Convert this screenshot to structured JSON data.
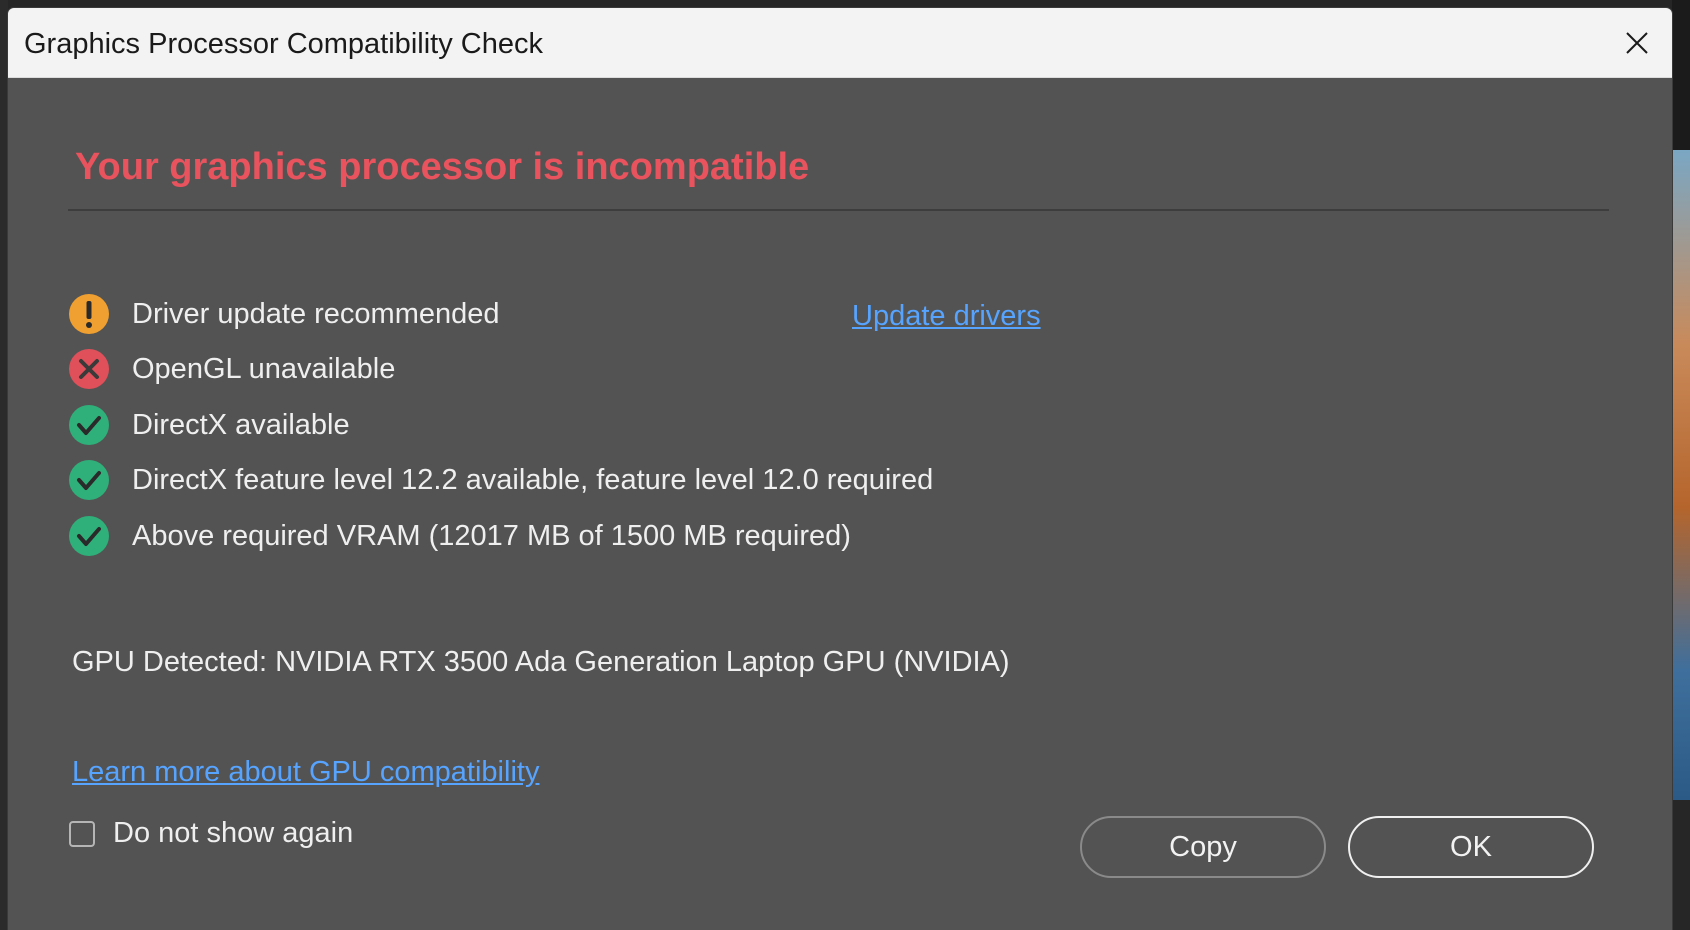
{
  "window": {
    "title": "Graphics Processor Compatibility Check"
  },
  "heading": "Your graphics processor is incompatible",
  "checks": [
    {
      "status": "warning",
      "icon": "warning-icon",
      "text": "Driver update recommended",
      "color": "#f0a030"
    },
    {
      "status": "error",
      "icon": "error-icon",
      "text": "OpenGL unavailable",
      "color": "#e0505a"
    },
    {
      "status": "ok",
      "icon": "check-icon",
      "text": "DirectX available",
      "color": "#2fb07a"
    },
    {
      "status": "ok",
      "icon": "check-icon",
      "text": "DirectX feature level 12.2 available, feature level 12.0 required",
      "color": "#2fb07a"
    },
    {
      "status": "ok",
      "icon": "check-icon",
      "text": "Above required VRAM (12017 MB of 1500 MB required)",
      "color": "#2fb07a"
    }
  ],
  "update_drivers_link": "Update drivers",
  "gpu_detected": "GPU Detected: NVIDIA RTX 3500 Ada Generation Laptop GPU (NVIDIA)",
  "learn_more_link": "Learn more about GPU compatibility",
  "do_not_show": {
    "label": "Do not show again",
    "checked": false
  },
  "buttons": {
    "copy": "Copy",
    "ok": "OK"
  },
  "colors": {
    "heading": "#e8535d",
    "link": "#56a4ff",
    "dialog_bg": "#535353",
    "titlebar_bg": "#f3f3f3"
  }
}
